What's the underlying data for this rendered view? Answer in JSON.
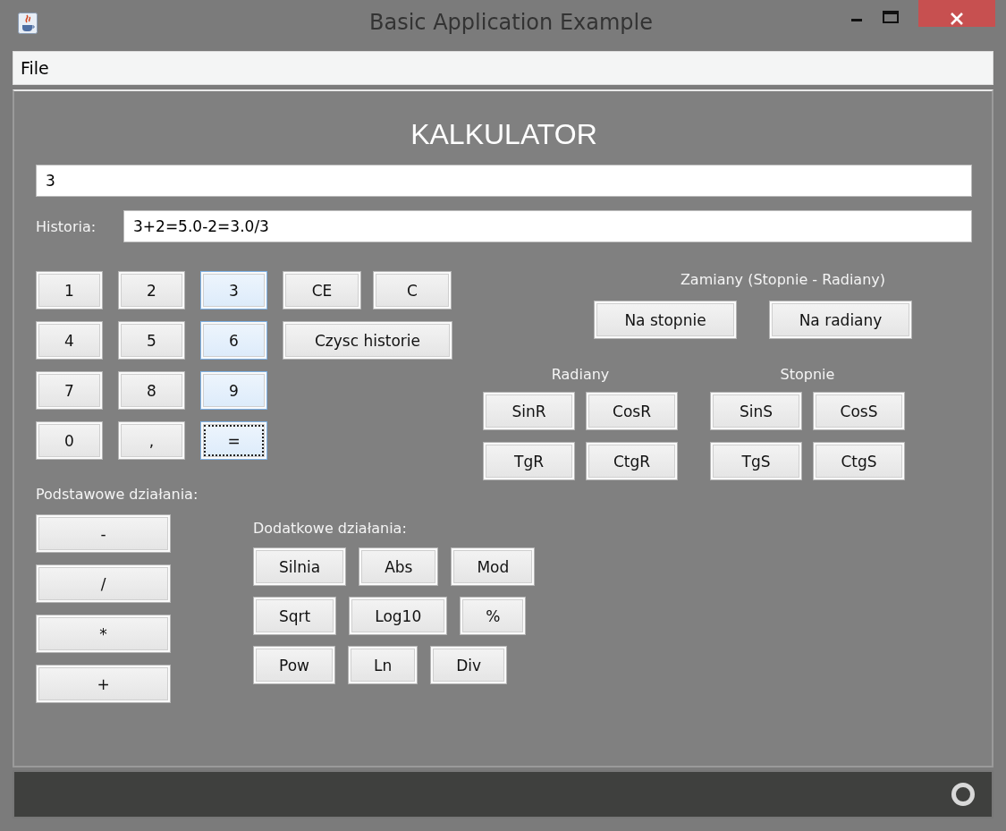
{
  "window": {
    "title": "Basic Application Example"
  },
  "menu": [
    {
      "label": "File"
    }
  ],
  "heading": "KALKULATOR",
  "display": {
    "value": "3"
  },
  "history": {
    "label": "Historia:",
    "value": "3+2=5.0-2=3.0/3"
  },
  "keypad_rows": [
    [
      {
        "label": "1",
        "kind": "digit",
        "highlighted": false,
        "focused": false
      },
      {
        "label": "2",
        "kind": "digit",
        "highlighted": false,
        "focused": false
      },
      {
        "label": "3",
        "kind": "digit",
        "highlighted": true,
        "focused": false
      },
      {
        "label": "CE",
        "kind": "clear",
        "highlighted": false,
        "focused": false
      },
      {
        "label": "C",
        "kind": "clear",
        "highlighted": false,
        "focused": false
      }
    ],
    [
      {
        "label": "4",
        "kind": "digit",
        "highlighted": false,
        "focused": false
      },
      {
        "label": "5",
        "kind": "digit",
        "highlighted": false,
        "focused": false
      },
      {
        "label": "6",
        "kind": "digit",
        "highlighted": true,
        "focused": false
      },
      {
        "label": "Czysc historie",
        "kind": "history",
        "highlighted": false,
        "focused": false
      }
    ],
    [
      {
        "label": "7",
        "kind": "digit",
        "highlighted": false,
        "focused": false
      },
      {
        "label": "8",
        "kind": "digit",
        "highlighted": false,
        "focused": false
      },
      {
        "label": "9",
        "kind": "digit",
        "highlighted": true,
        "focused": false
      }
    ],
    [
      {
        "label": "0",
        "kind": "digit",
        "highlighted": false,
        "focused": false
      },
      {
        "label": ",",
        "kind": "digit",
        "highlighted": false,
        "focused": false
      },
      {
        "label": "=",
        "kind": "digit",
        "highlighted": true,
        "focused": true
      }
    ]
  ],
  "conversions": {
    "title": "Zamiany (Stopnie - Radiany)",
    "buttons": [
      "Na stopnie",
      "Na radiany"
    ]
  },
  "trig_groups": [
    {
      "title": "Radiany",
      "buttons": [
        [
          "SinR",
          "CosR"
        ],
        [
          "TgR",
          "CtgR"
        ]
      ]
    },
    {
      "title": "Stopnie",
      "buttons": [
        [
          "SinS",
          "CosS"
        ],
        [
          "TgS",
          "CtgS"
        ]
      ]
    }
  ],
  "basic": {
    "title": "Podstawowe działania:",
    "buttons": [
      "-",
      "/",
      "*",
      "+"
    ]
  },
  "extra": {
    "title": "Dodatkowe działania:",
    "rows": [
      [
        "Silnia",
        "Abs",
        "Mod"
      ],
      [
        "Sqrt",
        "Log10",
        "%"
      ],
      [
        "Pow",
        "Ln",
        "Div"
      ]
    ]
  }
}
